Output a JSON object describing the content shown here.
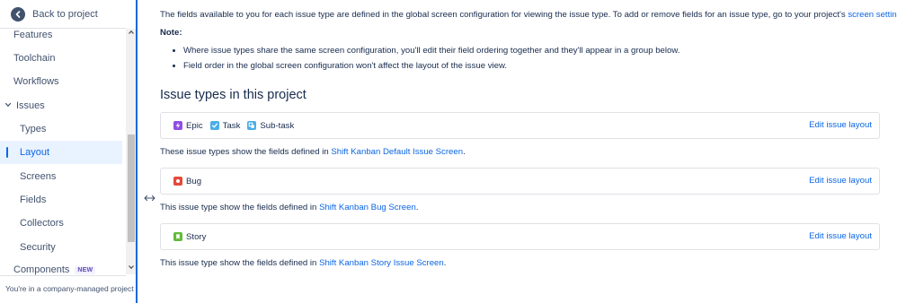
{
  "sidebar": {
    "back_label": "Back to project",
    "items": [
      {
        "label": "Features"
      },
      {
        "label": "Toolchain"
      },
      {
        "label": "Workflows"
      },
      {
        "label": "Issues"
      },
      {
        "label": "Types"
      },
      {
        "label": "Layout"
      },
      {
        "label": "Screens"
      },
      {
        "label": "Fields"
      },
      {
        "label": "Collectors"
      },
      {
        "label": "Security"
      },
      {
        "label": "Components",
        "badge": "NEW"
      }
    ],
    "selected": "Layout",
    "footer_text": "You're in a company-managed project"
  },
  "main": {
    "intro_text": "The fields available to you for each issue type are defined in the global screen configuration for viewing the issue type. To add or remove fields for an issue type, go to your project's ",
    "intro_link": "screen settings",
    "intro_end": ".",
    "note_label": "Note:",
    "bullets": [
      "Where issue types share the same screen configuration, you'll edit their field ordering together and they'll appear in a group below.",
      "Field order in the global screen configuration won't affect the layout of the issue view."
    ],
    "section_title": "Issue types in this project",
    "groups": [
      {
        "types": [
          {
            "name": "Epic",
            "icon": "epic-icon",
            "color": "#904ee2"
          },
          {
            "name": "Task",
            "icon": "task-icon",
            "color": "#4bade8"
          },
          {
            "name": "Sub-task",
            "icon": "subtask-icon",
            "color": "#4bade8"
          }
        ],
        "edit_label": "Edit issue layout",
        "desc_prefix": "These issue types show the fields defined in ",
        "desc_link": "Shift Kanban Default Issue Screen",
        "desc_suffix": "."
      },
      {
        "types": [
          {
            "name": "Bug",
            "icon": "bug-icon",
            "color": "#e5493a"
          }
        ],
        "edit_label": "Edit issue layout",
        "desc_prefix": "This issue type show the fields defined in ",
        "desc_link": "Shift Kanban Bug Screen",
        "desc_suffix": "."
      },
      {
        "types": [
          {
            "name": "Story",
            "icon": "story-icon",
            "color": "#63ba3c"
          }
        ],
        "edit_label": "Edit issue layout",
        "desc_prefix": "This issue type show the fields defined in ",
        "desc_link": "Shift Kanban Story Issue Screen",
        "desc_suffix": "."
      }
    ]
  },
  "colors": {
    "accent": "#0c66e4",
    "selected_bg": "#e9f2ff",
    "divider": "#1868db"
  }
}
